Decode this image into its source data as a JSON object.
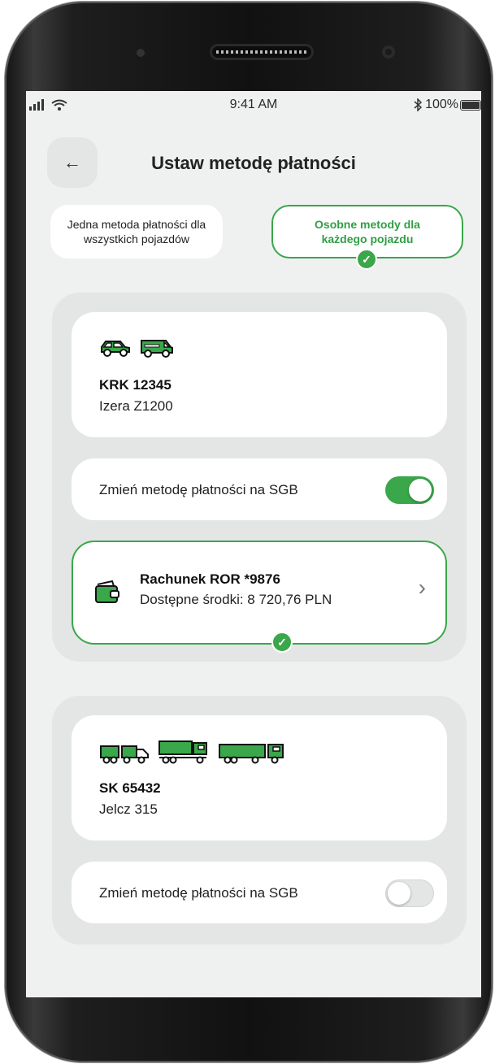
{
  "status_bar": {
    "signal_icon": "cellular-signal-icon",
    "wifi_icon": "wifi-icon",
    "time": "9:41 AM",
    "bluetooth_icon": "bluetooth-icon",
    "battery": "100%"
  },
  "header": {
    "back_icon": "arrow-left-icon",
    "back_glyph": "←",
    "title": "Ustaw metodę płatności"
  },
  "payment_mode": {
    "option_single": "Jedna metoda płatności dla wszystkich pojazdów",
    "option_separate": "Osobne metody dla każdego pojazdu",
    "selected": "option_separate"
  },
  "vehicles": [
    {
      "plate": "KRK 12345",
      "model": "Izera Z1200",
      "icons": [
        "car-icon",
        "van-icon"
      ],
      "toggle_label": "Zmień metodę płatności na SGB",
      "toggle_on": true,
      "account": {
        "name": "Rachunek ROR *9876",
        "balance": "Dostępne środki: 8 720,76 PLN",
        "icon": "wallet-icon",
        "chevron": "›"
      }
    },
    {
      "plate": "SK 65432",
      "model": "Jelcz 315",
      "icons": [
        "truck-trailer-icon",
        "semi-truck-icon",
        "long-truck-icon"
      ],
      "toggle_label": "Zmień metodę płatności na SGB",
      "toggle_on": false
    }
  ],
  "colors": {
    "accent": "#3aa74a",
    "background": "#eff1f0",
    "panel": "#e3e6e5",
    "card": "#ffffff"
  },
  "check_glyph": "✓"
}
